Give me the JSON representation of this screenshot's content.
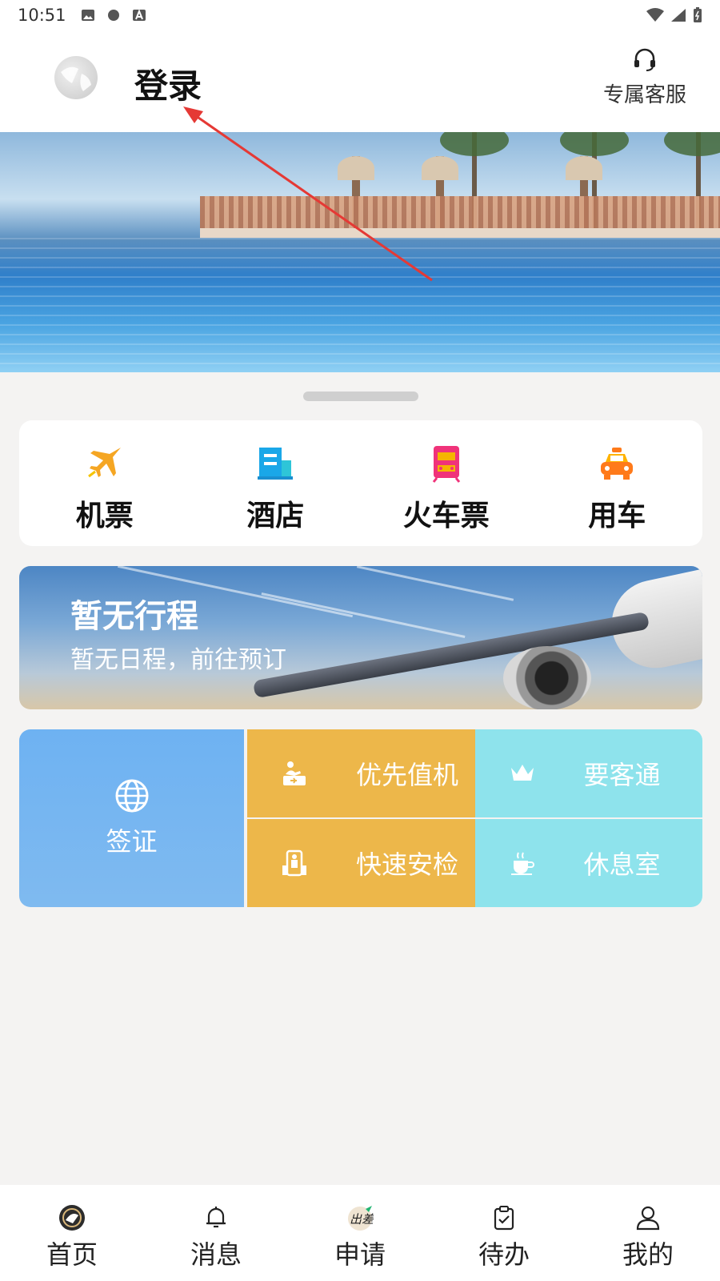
{
  "status_bar": {
    "time": "10:51"
  },
  "header": {
    "login_label": "登录",
    "service_label": "专属客服",
    "service_icon": "headset-icon",
    "avatar_icon": "avatar-placeholder-icon"
  },
  "banner": {
    "image": "resort-pool-seaside"
  },
  "services": [
    {
      "label": "机票",
      "icon": "airplane-icon",
      "color": "#f5a623"
    },
    {
      "label": "酒店",
      "icon": "hotel-icon",
      "color": "#1aa7e8"
    },
    {
      "label": "火车票",
      "icon": "train-icon",
      "color": "#f0337a"
    },
    {
      "label": "用车",
      "icon": "car-icon",
      "color": "#ff7a1a"
    }
  ],
  "trip": {
    "title": "暂无行程",
    "subtitle": "暂无日程，前往预订"
  },
  "extras": {
    "visa": {
      "label": "签证",
      "icon": "globe-icon"
    },
    "items": [
      {
        "label": "优先值机",
        "icon": "checkin-icon"
      },
      {
        "label": "要客通",
        "icon": "crown-icon"
      },
      {
        "label": "快速安检",
        "icon": "security-icon"
      },
      {
        "label": "休息室",
        "icon": "coffee-icon"
      }
    ]
  },
  "bottom_nav": [
    {
      "label": "首页",
      "icon": "home-logo-icon"
    },
    {
      "label": "消息",
      "icon": "bell-icon"
    },
    {
      "label": "申请",
      "icon": "apply-icon"
    },
    {
      "label": "待办",
      "icon": "clipboard-check-icon"
    },
    {
      "label": "我的",
      "icon": "user-icon"
    }
  ],
  "colors": {
    "gold": "#edb74a",
    "aqua": "#8ee3ec",
    "visa_blue": "#6eb2f2",
    "arrow_red": "#e53935"
  }
}
